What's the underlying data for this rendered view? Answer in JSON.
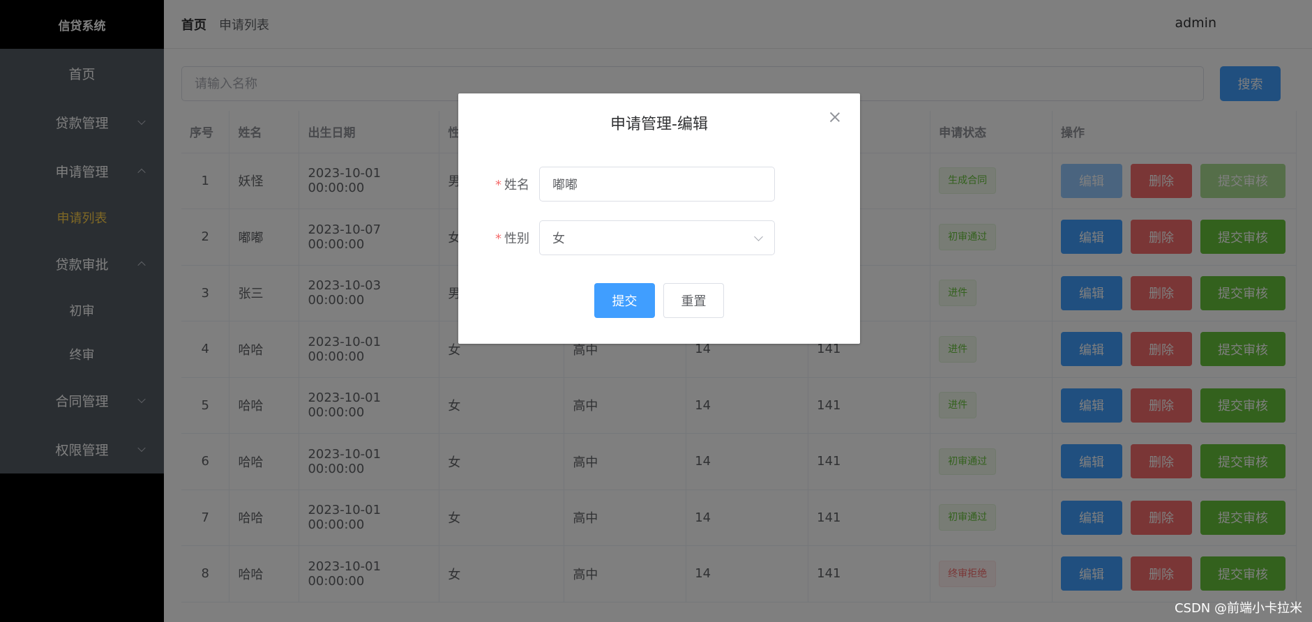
{
  "app": {
    "title": "信贷系统",
    "user": "admin"
  },
  "header": {
    "breadcrumb_home": "首页",
    "breadcrumb_current": "申请列表"
  },
  "sidebar": {
    "items": [
      {
        "label": "首页"
      },
      {
        "label": "贷款管理"
      },
      {
        "label": "申请管理"
      },
      {
        "label": "申请列表"
      },
      {
        "label": "贷款审批"
      },
      {
        "label": "初审"
      },
      {
        "label": "终审"
      },
      {
        "label": "合同管理"
      },
      {
        "label": "权限管理"
      }
    ]
  },
  "search": {
    "placeholder": "请输入名称",
    "button_label": "搜索"
  },
  "table": {
    "headers": [
      "序号",
      "姓名",
      "出生日期",
      "性",
      "",
      "",
      "",
      "申请状态",
      "操作"
    ],
    "rows": [
      {
        "no": "1",
        "name": "妖怪",
        "birth": "2023-10-01 00:00:00",
        "gender": "男",
        "edu": "",
        "c5": "",
        "c6": "",
        "status": "生成合同",
        "status_type": "success"
      },
      {
        "no": "2",
        "name": "嘟嘟",
        "birth": "2023-10-07 00:00:00",
        "gender": "女",
        "edu": "",
        "c5": "",
        "c6": "",
        "status": "初审通过",
        "status_type": "success"
      },
      {
        "no": "3",
        "name": "张三",
        "birth": "2023-10-03 00:00:00",
        "gender": "男",
        "edu": "",
        "c5": "",
        "c6": "",
        "status": "进件",
        "status_type": "success"
      },
      {
        "no": "4",
        "name": "哈哈",
        "birth": "2023-10-01 00:00:00",
        "gender": "女",
        "edu": "高中",
        "c5": "14",
        "c6": "141",
        "status": "进件",
        "status_type": "success"
      },
      {
        "no": "5",
        "name": "哈哈",
        "birth": "2023-10-01 00:00:00",
        "gender": "女",
        "edu": "高中",
        "c5": "14",
        "c6": "141",
        "status": "进件",
        "status_type": "success"
      },
      {
        "no": "6",
        "name": "哈哈",
        "birth": "2023-10-01 00:00:00",
        "gender": "女",
        "edu": "高中",
        "c5": "14",
        "c6": "141",
        "status": "初审通过",
        "status_type": "success"
      },
      {
        "no": "7",
        "name": "哈哈",
        "birth": "2023-10-01 00:00:00",
        "gender": "女",
        "edu": "高中",
        "c5": "14",
        "c6": "141",
        "status": "初审通过",
        "status_type": "success"
      },
      {
        "no": "8",
        "name": "哈哈",
        "birth": "2023-10-01 00:00:00",
        "gender": "女",
        "edu": "高中",
        "c5": "14",
        "c6": "141",
        "status": "终审拒绝",
        "status_type": "danger"
      }
    ],
    "actions": {
      "edit": "编辑",
      "delete": "删除",
      "submit": "提交审核"
    }
  },
  "dialog": {
    "title": "申请管理-编辑",
    "name_label": "姓名",
    "name_value": "嘟嘟",
    "gender_label": "性别",
    "gender_value": "女",
    "required_mark": "*",
    "submit_label": "提交",
    "reset_label": "重置"
  },
  "watermark": "CSDN @前端小卡拉米",
  "colors": {
    "primary": "#409eff",
    "danger": "#f56c6c",
    "success": "#67c23a",
    "menu_bg": "#545c64",
    "menu_active": "#ffd04b"
  }
}
